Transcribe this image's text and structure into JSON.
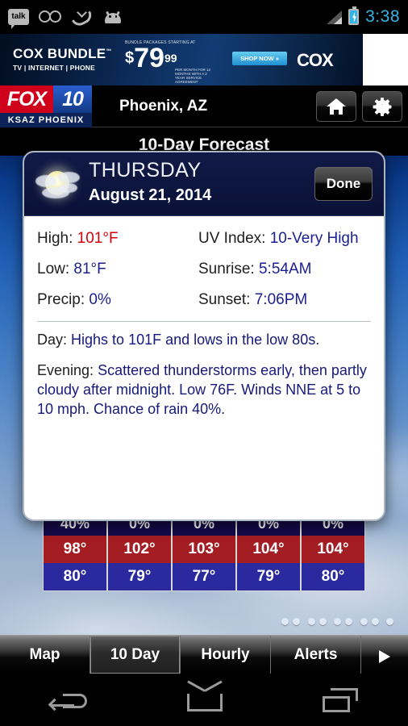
{
  "status_bar": {
    "icons": [
      "talk-icon",
      "voicemail-icon",
      "missed-call-icon",
      "android-icon",
      "wifi-icon",
      "signal-icon",
      "battery-charging-icon"
    ],
    "talk_label": "talk",
    "time": "3:38"
  },
  "ad": {
    "brand_line1": "COX BUNDLE",
    "trademark": "™",
    "brand_line2": "TV | INTERNET | PHONE",
    "eyebrow": "BUNDLE PACKAGES STARTING AT",
    "dollar_sign": "$",
    "price": "79",
    "cents": "99",
    "legal": "PER MONTH FOR 12 MONTHS WITH A 2 YEAR SERVICE AGREEMENT",
    "shop_now": "SHOP NOW »",
    "logo": "COX"
  },
  "app_header": {
    "logo_fox": "FOX",
    "logo_ten": "10",
    "logo_sub": "KSAZ PHOENIX",
    "location": "Phoenix, AZ",
    "home_button": "home-icon",
    "settings_button": "gear-icon"
  },
  "page": {
    "title": "10-Day Forecast"
  },
  "forecast_strip": {
    "cards": [
      {
        "precip": "40%",
        "high": "98°",
        "low": "80°"
      },
      {
        "precip": "0%",
        "high": "102°",
        "low": "79°"
      },
      {
        "precip": "0%",
        "high": "103°",
        "low": "77°"
      },
      {
        "precip": "0%",
        "high": "104°",
        "low": "79°"
      },
      {
        "precip": "0%",
        "high": "104°",
        "low": "80°"
      }
    ],
    "page_dots": 9
  },
  "dialog": {
    "weather_icon": "partly-cloudy-icon",
    "day": "THURSDAY",
    "date": "August 21, 2014",
    "done_label": "Done",
    "details": [
      {
        "label": "High:",
        "value": "101°F",
        "accent": "hot"
      },
      {
        "label": "UV Index:",
        "value": "10-Very High",
        "accent": "cool"
      },
      {
        "label": "Low:",
        "value": "81°F",
        "accent": "cool"
      },
      {
        "label": "Sunrise:",
        "value": "5:54AM",
        "accent": "cool"
      },
      {
        "label": "Precip:",
        "value": "0%",
        "accent": "cool"
      },
      {
        "label": "Sunset:",
        "value": "7:06PM",
        "accent": "cool"
      }
    ],
    "day_label": "Day:",
    "day_text": "Highs to 101F and lows in the low 80s.",
    "evening_label": "Evening:",
    "evening_text": "Scattered thunderstorms early, then partly cloudy after midnight. Low 76F. Winds NNE at 5 to 10 mph. Chance of rain 40%."
  },
  "tabs": [
    {
      "label": "Map",
      "selected": false
    },
    {
      "label": "10 Day",
      "selected": true
    },
    {
      "label": "Hourly",
      "selected": false
    },
    {
      "label": "Alerts",
      "selected": false
    }
  ],
  "tab_more_icon": "play-arrow-icon",
  "nav_bar": {
    "back": "back-icon",
    "home": "home-icon",
    "recents": "recents-icon"
  },
  "colors": {
    "accent_blue": "#33b5e5",
    "high_red": "#d1000b",
    "value_blue": "#1a1f8f",
    "card_high": "#a31d22",
    "card_low": "#2a2a9e"
  }
}
